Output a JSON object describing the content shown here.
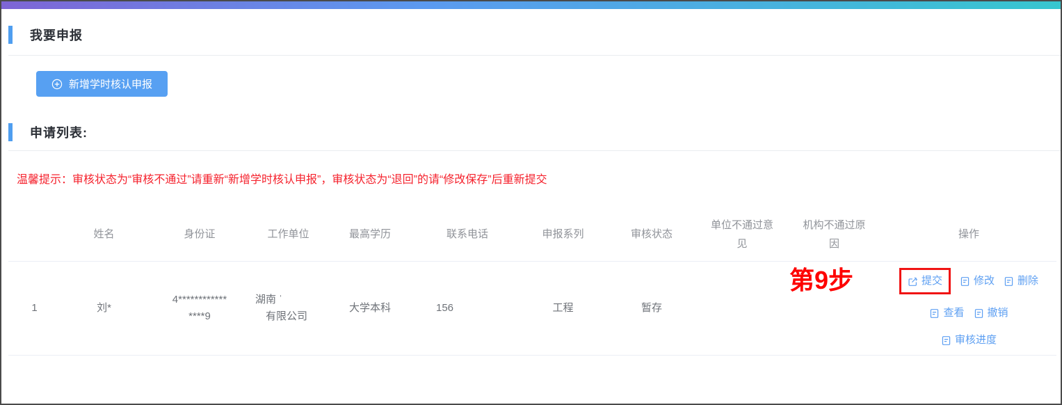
{
  "sections": {
    "declare_title": "我要申报",
    "list_title": "申请列表:"
  },
  "toolbar": {
    "add_button_label": "新增学时核认申报"
  },
  "tip_text": "温馨提示：审核状态为“审核不通过”请重新“新增学时核认申报”，审核状态为“退回”的请“修改保存”后重新提交",
  "annotation": {
    "step_label": "第9步"
  },
  "table": {
    "headers": [
      "",
      "姓名",
      "身份证",
      "工作单位",
      "最高学历",
      "联系电话",
      "申报系列",
      "审核状态",
      "单位不通过意见",
      "机构不通过原因",
      "操作"
    ],
    "rows": [
      {
        "index": "1",
        "name": "刘*",
        "id_line1": "4************",
        "id_line2": "****9",
        "work_unit_line1": "湖南 ˈ",
        "work_unit_line2": "有限公司",
        "education": "大学本科",
        "phone": "156",
        "series": "工程",
        "status": "暂存",
        "unit_reject_opinion": "",
        "org_reject_reason": ""
      }
    ],
    "actions": {
      "submit": "提交",
      "modify": "修改",
      "delete": "删除",
      "view": "查看",
      "revoke": "撤销",
      "progress": "审核进度"
    }
  },
  "icons": {
    "add_button_icon": "plus-circle-icon",
    "submit_icon": "edit-square-icon",
    "other_action_icon": "document-icon"
  },
  "colors": {
    "gradient_left": "#7e65d5",
    "gradient_mid": "#5b9af0",
    "gradient_right": "#37c6cf",
    "accent_blue": "#4f9ef0",
    "button_blue": "#57a0f2",
    "link_blue": "#5d9ff2",
    "tip_red": "#f5222d",
    "annotation_red": "#fe0100",
    "highlight_box_red": "#f01414",
    "heading_text": "#2b2f36",
    "header_text": "#909399",
    "cell_text": "#6e7278"
  }
}
